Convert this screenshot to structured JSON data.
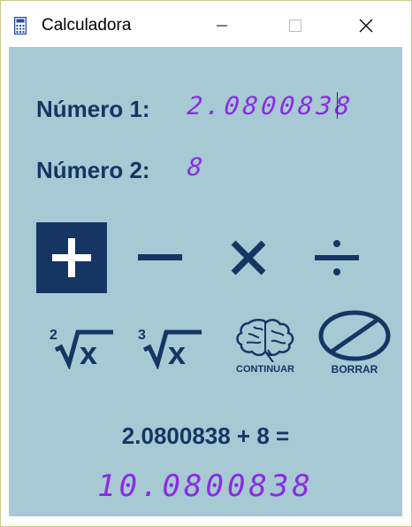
{
  "window": {
    "title": "Calculadora"
  },
  "inputs": {
    "number1_label": "Número 1:",
    "number1_value": "2.0800838",
    "number2_label": "Número 2:",
    "number2_value": "8"
  },
  "operations": {
    "selected": "add",
    "items": [
      {
        "id": "add",
        "icon": "plus-icon"
      },
      {
        "id": "subtract",
        "icon": "minus-icon"
      },
      {
        "id": "multiply",
        "icon": "times-icon"
      },
      {
        "id": "divide",
        "icon": "divide-icon"
      }
    ]
  },
  "functions": {
    "square_root_index": "2",
    "cube_root_index": "3",
    "root_symbol": "x",
    "continue_label": "CONTINUAR",
    "clear_label": "BORRAR"
  },
  "result": {
    "expression": "2.0800838 + 8 =",
    "value": "10.0800838"
  },
  "colors": {
    "background": "#a6c9d4",
    "primary": "#153563",
    "display": "#8a2be2"
  }
}
